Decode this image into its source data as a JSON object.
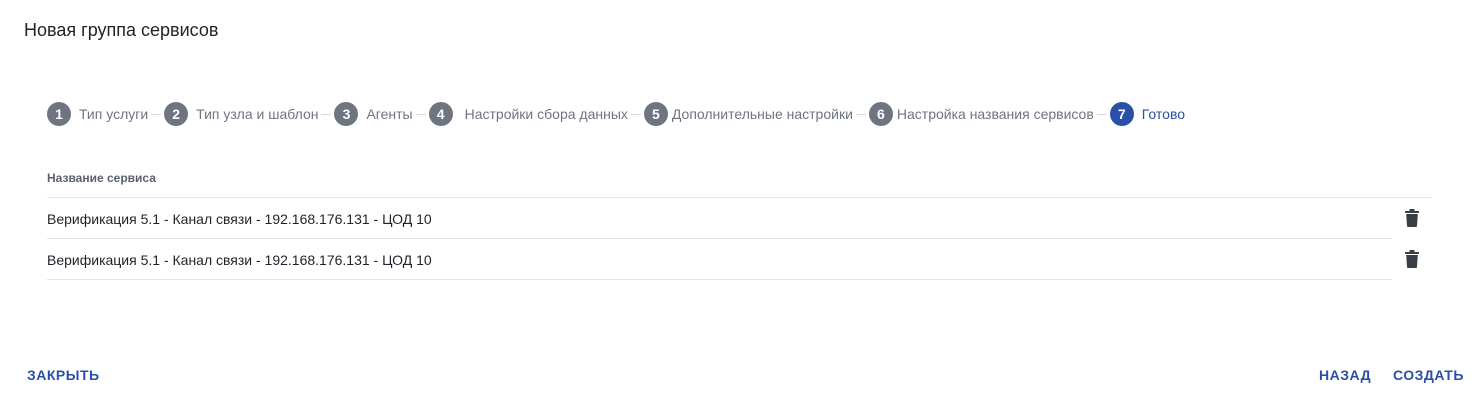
{
  "dialog": {
    "title": "Новая группа сервисов"
  },
  "stepper": {
    "steps": [
      {
        "number": "1",
        "label": "Тип услуги"
      },
      {
        "number": "2",
        "label": "Тип узла и шаблон"
      },
      {
        "number": "3",
        "label": "Агенты"
      },
      {
        "number": "4",
        "label": "Настройки сбора данных"
      },
      {
        "number": "5",
        "label": "Дополнительные настройки"
      },
      {
        "number": "6",
        "label": "Настройка названия сервисов"
      },
      {
        "number": "7",
        "label": "Готово"
      }
    ],
    "active_step": 7
  },
  "table": {
    "header": "Название сервиса",
    "rows": [
      {
        "name": "Верификация 5.1 - Канал связи - 192.168.176.131 - ЦОД 10",
        "action_icon": "trash-icon"
      },
      {
        "name": "Верификация 5.1 - Канал связи - 192.168.176.131 - ЦОД 10",
        "action_icon": "trash-icon"
      }
    ]
  },
  "footer": {
    "close_label": "ЗАКРЫТЬ",
    "back_label": "НАЗАД",
    "create_label": "СОЗДАТЬ"
  },
  "colors": {
    "accent": "#2a4fa8",
    "step_inactive": "#6e7480",
    "text": "#1f2329",
    "divider": "#e2e4e8"
  }
}
